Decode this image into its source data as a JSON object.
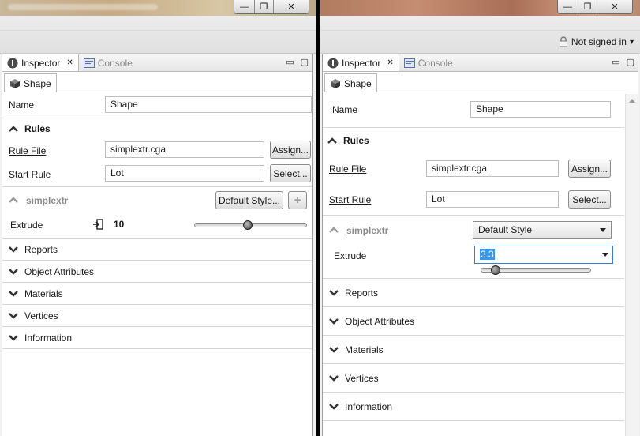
{
  "left": {
    "window_buttons": {
      "min": "—",
      "max": "❐",
      "close": "✕"
    },
    "tabs": [
      {
        "label": "Inspector",
        "close": "✕"
      },
      {
        "label": "Console"
      }
    ],
    "view_controls": {
      "min": "▭",
      "max": "▢"
    },
    "subtab": "Shape",
    "name": {
      "label": "Name",
      "value": "Shape"
    },
    "rules": {
      "title": "Rules"
    },
    "rule_file": {
      "label": "Rule File",
      "value": "simplextr.cga",
      "button": "Assign..."
    },
    "start_rule": {
      "label": "Start Rule",
      "value": "Lot",
      "button": "Select..."
    },
    "style_section": {
      "title": "simplextr",
      "button": "Default Style...",
      "add": "+"
    },
    "extrude": {
      "label": "Extrude",
      "value": "10",
      "slider_fraction": 0.47
    },
    "sections": [
      "Reports",
      "Object Attributes",
      "Materials",
      "Vertices",
      "Information"
    ]
  },
  "right": {
    "window_buttons": {
      "min": "—",
      "max": "❐",
      "close": "✕"
    },
    "signin": {
      "label": "Not signed in",
      "arrow": "▾"
    },
    "tabs": [
      {
        "label": "Inspector",
        "close": "✕"
      },
      {
        "label": "Console"
      }
    ],
    "view_controls": {
      "min": "▭",
      "max": "▢"
    },
    "subtab": "Shape",
    "name": {
      "label": "Name",
      "value": "Shape"
    },
    "rules": {
      "title": "Rules"
    },
    "rule_file": {
      "label": "Rule File",
      "value": "simplextr.cga",
      "button": "Assign..."
    },
    "start_rule": {
      "label": "Start Rule",
      "value": "Lot",
      "button": "Select..."
    },
    "style_section": {
      "title": "simplextr",
      "combo": "Default Style"
    },
    "extrude": {
      "label": "Extrude",
      "value": "3.3",
      "slider_fraction": 0.1
    },
    "sections": [
      "Reports",
      "Object Attributes",
      "Materials",
      "Vertices",
      "Information"
    ]
  },
  "colors": {
    "selection": "#3399ff",
    "text": "#1a1a1a",
    "disabled": "#8c8c8c",
    "border": "#a0a0a0"
  }
}
